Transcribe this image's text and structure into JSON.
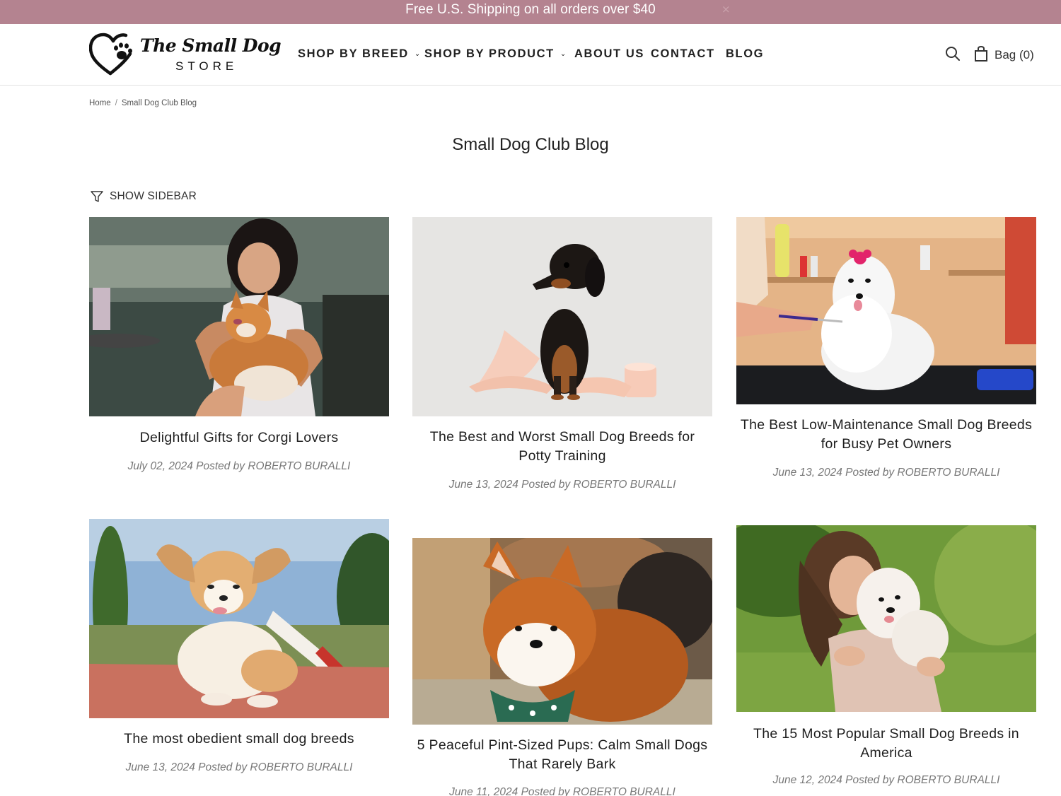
{
  "announcement": {
    "text": "Free U.S. Shipping on all orders over $40",
    "close": "×"
  },
  "logo": {
    "line1": "The Small Dog",
    "line2": "STORE"
  },
  "nav": {
    "items": [
      {
        "label": "SHOP BY BREED",
        "has_dropdown": true
      },
      {
        "label": "SHOP BY PRODUCT",
        "has_dropdown": true
      },
      {
        "label": "ABOUT US",
        "has_dropdown": false
      },
      {
        "label": "CONTACT",
        "has_dropdown": false
      },
      {
        "label": "BLOG",
        "has_dropdown": false
      }
    ],
    "chevron": "⌄"
  },
  "header_actions": {
    "search_icon": "search-icon",
    "bag_label": "Bag (0)"
  },
  "breadcrumb": {
    "home": "Home",
    "separator": "/",
    "current": "Small Dog Club Blog"
  },
  "page_title": "Small Dog Club Blog",
  "sidebar_toggle": {
    "label": "SHOW SIDEBAR",
    "icon": "filter-icon"
  },
  "posts": [
    {
      "title": "Delightful Gifts for Corgi Lovers",
      "meta": "July 02, 2024 Posted by ROBERTO BURALLI",
      "image": "woman holding corgi"
    },
    {
      "title": "The Best and Worst Small Dog Breeds for Potty Training",
      "meta": "June 13, 2024 Posted by ROBERTO BURALLI",
      "image": "dachshund with toilet paper"
    },
    {
      "title": "The Best Low-Maintenance Small Dog Breeds for Busy Pet Owners",
      "meta": "June 13, 2024 Posted by ROBERTO BURALLI",
      "image": "maltese being groomed"
    },
    {
      "title": "The most obedient small dog breeds",
      "meta": "June 13, 2024 Posted by ROBERTO BURALLI",
      "image": "chihuahua on agility field"
    },
    {
      "title": "5 Peaceful Pint-Sized Pups: Calm Small Dogs That Rarely Bark",
      "meta": "June 11, 2024 Posted by ROBERTO BURALLI",
      "image": "shiba inu with bandana"
    },
    {
      "title": "The 15 Most Popular Small Dog Breeds in America",
      "meta": "June 12, 2024 Posted by ROBERTO BURALLI",
      "image": "woman hugging white dog"
    }
  ],
  "colors": {
    "announcement_bg": "#b48390",
    "text": "#222222",
    "meta": "#777777"
  }
}
